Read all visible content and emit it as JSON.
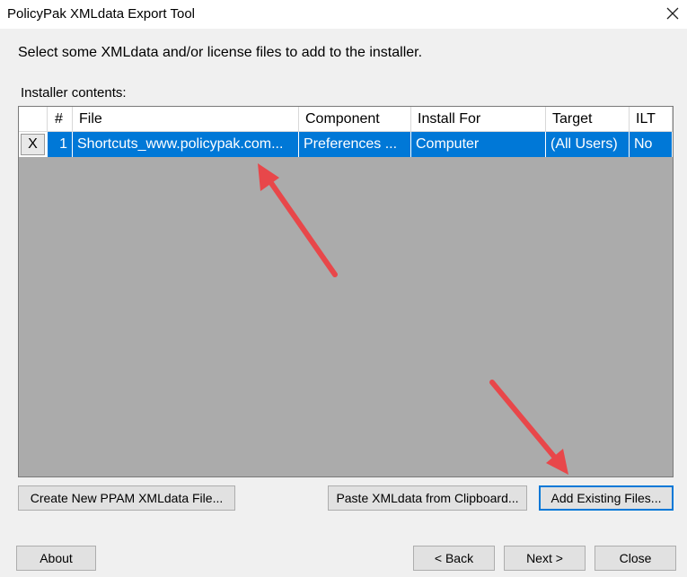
{
  "window": {
    "title": "PolicyPak XMLdata Export Tool",
    "close_icon": "close-icon"
  },
  "instruction": "Select some XMLdata and/or license files to add to the installer.",
  "contents_label": "Installer contents:",
  "grid": {
    "columns": [
      "",
      "#",
      "File",
      "Component",
      "Install For",
      "Target",
      "ILT"
    ],
    "rows": [
      {
        "remove_label": "X",
        "num": "1",
        "file": "Shortcuts_www.policypak.com...",
        "component": "Preferences ...",
        "install_for": "Computer",
        "target": "(All Users)",
        "ilt": "No",
        "selected": true
      }
    ],
    "selection_color": "#0078d7"
  },
  "buttons": {
    "create_new": "Create New PPAM XMLdata File...",
    "paste": "Paste XMLdata from Clipboard...",
    "add_existing": "Add Existing Files...",
    "about": "About",
    "back": "< Back",
    "next": "Next >",
    "close": "Close"
  },
  "annotation_color": "#e8474a"
}
